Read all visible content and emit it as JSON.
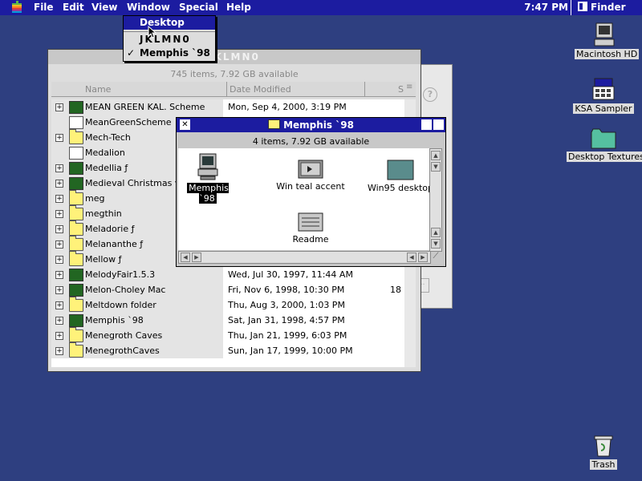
{
  "menubar": {
    "items": [
      "File",
      "Edit",
      "View",
      "Window",
      "Special",
      "Help"
    ],
    "clock": "7:47 PM",
    "app": "Finder",
    "apple_icon": "apple-logo-icon"
  },
  "window_menu": {
    "items": [
      "Desktop",
      "JKLMN0",
      "Memphis `98"
    ],
    "checked": "Memphis `98",
    "hovered": "Desktop"
  },
  "list_window": {
    "title": "JKLMN0",
    "info": "745 items, 7.92 GB available",
    "columns": {
      "name": "Name",
      "date": "Date Modified",
      "size": "S"
    },
    "rows": [
      {
        "name": "MEAN GREEN KAL. Scheme",
        "date": "Mon, Sep 4, 2000, 3:19 PM",
        "size": "",
        "kind": "app"
      },
      {
        "name": "MeanGreenScheme",
        "date": "",
        "size": "",
        "kind": "doc"
      },
      {
        "name": "Mech-Tech",
        "date": "",
        "size": "",
        "kind": "folder"
      },
      {
        "name": "Medalion",
        "date": "",
        "size": "",
        "kind": "doc"
      },
      {
        "name": "Medellia ƒ",
        "date": "",
        "size": "",
        "kind": "app"
      },
      {
        "name": "Medieval Christmas v2",
        "date": "",
        "size": "",
        "kind": "app"
      },
      {
        "name": "meg",
        "date": "",
        "size": "",
        "kind": "folder"
      },
      {
        "name": "megthin",
        "date": "",
        "size": "",
        "kind": "folder"
      },
      {
        "name": "Meladorie ƒ",
        "date": "",
        "size": "",
        "kind": "folder"
      },
      {
        "name": "Melananthe ƒ",
        "date": "",
        "size": "",
        "kind": "folder"
      },
      {
        "name": "Mellow ƒ",
        "date": "",
        "size": "",
        "kind": "folder"
      },
      {
        "name": "MelodyFair1.5.3",
        "date": "Wed, Jul 30, 1997, 11:44 AM",
        "size": "",
        "kind": "app"
      },
      {
        "name": "Melon-Choley Mac",
        "date": "Fri, Nov 6, 1998, 10:30 PM",
        "size": "18",
        "kind": "app"
      },
      {
        "name": "Meltdown folder",
        "date": "Thu, Aug 3, 2000, 1:03 PM",
        "size": "",
        "kind": "folder"
      },
      {
        "name": "Memphis `98",
        "date": "Sat, Jan 31, 1998, 4:57 PM",
        "size": "",
        "kind": "app"
      },
      {
        "name": "Menegroth Caves",
        "date": "Thu, Jan 21, 1999, 6:03 PM",
        "size": "",
        "kind": "folder"
      },
      {
        "name": "MenegrothCaves",
        "date": "Sun, Jan 17, 1999, 10:00 PM",
        "size": "",
        "kind": "folder"
      }
    ]
  },
  "memphis_window": {
    "title": "Memphis `98",
    "info": "4 items, 7.92 GB available",
    "icons": [
      {
        "label": "Memphis `98",
        "icon": "computer-icon"
      },
      {
        "label": "Win teal accent",
        "icon": "document-icon"
      },
      {
        "label": "Win95 desktop",
        "icon": "picture-icon"
      },
      {
        "label": "Readme",
        "icon": "readme-icon"
      }
    ]
  },
  "desktop_icons": [
    {
      "label": "Macintosh HD",
      "icon": "hard-disk-icon"
    },
    {
      "label": "KSA Sampler",
      "icon": "sampler-icon"
    },
    {
      "label": "Desktop Textures",
      "icon": "folder-icon"
    },
    {
      "label": "Trash",
      "icon": "trash-icon"
    }
  ],
  "colors": {
    "desktop": "#2e3f80",
    "menubar": "#1c1ca0",
    "highlight": "#1c1ca0"
  }
}
